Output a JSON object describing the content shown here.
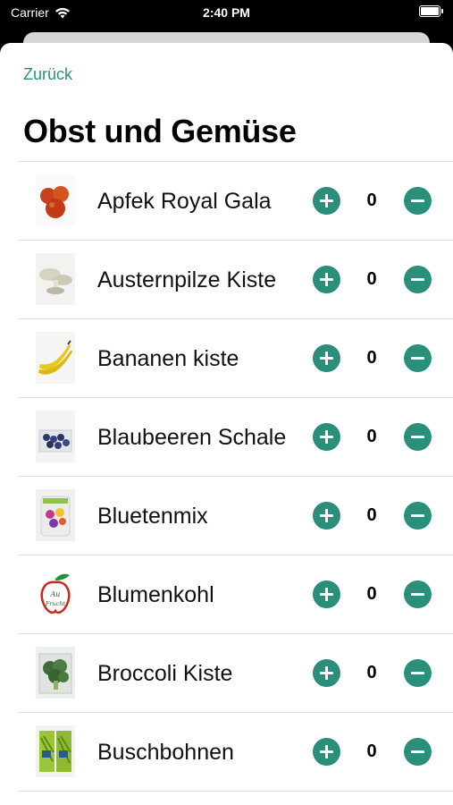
{
  "status_bar": {
    "carrier": "Carrier",
    "time": "2:40 PM"
  },
  "nav": {
    "back_label": "Zurück"
  },
  "page": {
    "title": "Obst und Gemüse"
  },
  "accent_color": "#2a8f7a",
  "items": [
    {
      "name": "Apfek Royal Gala",
      "quantity": "0",
      "image": "apple-icon"
    },
    {
      "name": "Austernpilze Kiste",
      "quantity": "0",
      "image": "mushroom-icon"
    },
    {
      "name": "Bananen kiste",
      "quantity": "0",
      "image": "banana-icon"
    },
    {
      "name": "Blaubeeren Schale",
      "quantity": "0",
      "image": "blueberry-icon"
    },
    {
      "name": "Bluetenmix",
      "quantity": "0",
      "image": "flower-mix-icon"
    },
    {
      "name": "Blumenkohl",
      "quantity": "0",
      "image": "logo-placeholder-icon"
    },
    {
      "name": "Broccoli Kiste",
      "quantity": "0",
      "image": "broccoli-icon"
    },
    {
      "name": "Buschbohnen",
      "quantity": "0",
      "image": "beans-icon"
    }
  ]
}
